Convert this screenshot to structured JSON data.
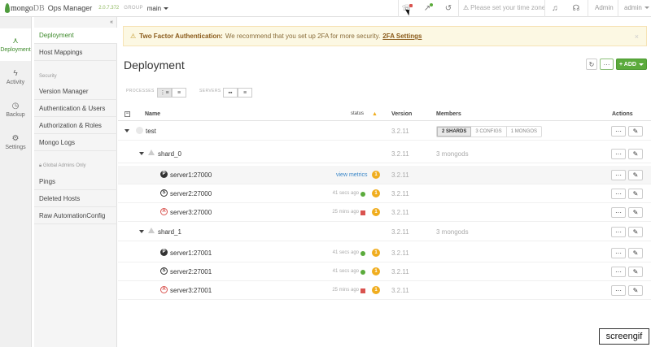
{
  "topbar": {
    "brand_mongo": "mongo",
    "brand_db": "DB",
    "product": "Ops Manager",
    "version": "2.0.7.372",
    "group_label": "GROUP",
    "group_name": "main",
    "timezone_placeholder": "Please set your time zone",
    "admin_link": "Admin",
    "user_menu": "admin"
  },
  "leftnav": [
    {
      "label": "Deployment",
      "icon": "deployment-icon"
    },
    {
      "label": "Activity",
      "icon": "activity-icon"
    },
    {
      "label": "Backup",
      "icon": "backup-icon"
    },
    {
      "label": "Settings",
      "icon": "gear-icon"
    }
  ],
  "subnav": {
    "collapse_glyph": "«",
    "items": [
      "Deployment",
      "Host Mappings"
    ],
    "security_header": "Security",
    "security_items": [
      "Version Manager",
      "Authentication & Users",
      "Authorization & Roles",
      "Mongo Logs"
    ],
    "global_header": "Global Admins Only",
    "global_items": [
      "Pings",
      "Deleted Hosts",
      "Raw AutomationConfig"
    ]
  },
  "alert": {
    "title": "Two Factor Authentication:",
    "message": "We recommend that you set up 2FA for more security.",
    "link": "2FA Settings",
    "close": "×"
  },
  "page": {
    "title": "Deployment",
    "add_label": "+ ADD",
    "more_label": "···",
    "processes_label": "PROCESSES",
    "servers_label": "SERVERS"
  },
  "table": {
    "headers": {
      "name": "Name",
      "status": "status",
      "version": "Version",
      "members": "Members",
      "actions": "Actions"
    },
    "cluster": {
      "name": "test",
      "version": "3.2.11",
      "pills": [
        "2 SHARDS",
        "3 CONFIGS",
        "1 MONGOS"
      ]
    },
    "shards": [
      {
        "name": "shard_0",
        "version": "3.2.11",
        "members": "3 mongods",
        "servers": [
          {
            "role": "P",
            "name": "server1:27000",
            "since": "",
            "link": "view metrics",
            "status": "none",
            "badge": "1",
            "version": "3.2.11"
          },
          {
            "role": "S",
            "name": "server2:27000",
            "since": "41 secs ago",
            "link": "",
            "status": "green",
            "badge": "1",
            "version": "3.2.11"
          },
          {
            "role": "A",
            "name": "server3:27000",
            "since": "25 mins ago",
            "link": "",
            "status": "red",
            "badge": "1",
            "version": "3.2.11"
          }
        ]
      },
      {
        "name": "shard_1",
        "version": "3.2.11",
        "members": "3 mongods",
        "servers": [
          {
            "role": "P",
            "name": "server1:27001",
            "since": "41 secs ago",
            "link": "",
            "status": "green",
            "badge": "1",
            "version": "3.2.11"
          },
          {
            "role": "S",
            "name": "server2:27001",
            "since": "41 secs ago",
            "link": "",
            "status": "green",
            "badge": "1",
            "version": "3.2.11"
          },
          {
            "role": "A",
            "name": "server3:27001",
            "since": "25 mins ago",
            "link": "",
            "status": "red",
            "badge": "1",
            "version": "3.2.11"
          }
        ]
      }
    ],
    "action_more": "···",
    "action_edit": "✎"
  },
  "watermark": "screengif",
  "colors": {
    "accent": "#5bab3c",
    "warning": "#f0ad1e",
    "danger": "#d9534f",
    "link": "#3a87c8"
  }
}
